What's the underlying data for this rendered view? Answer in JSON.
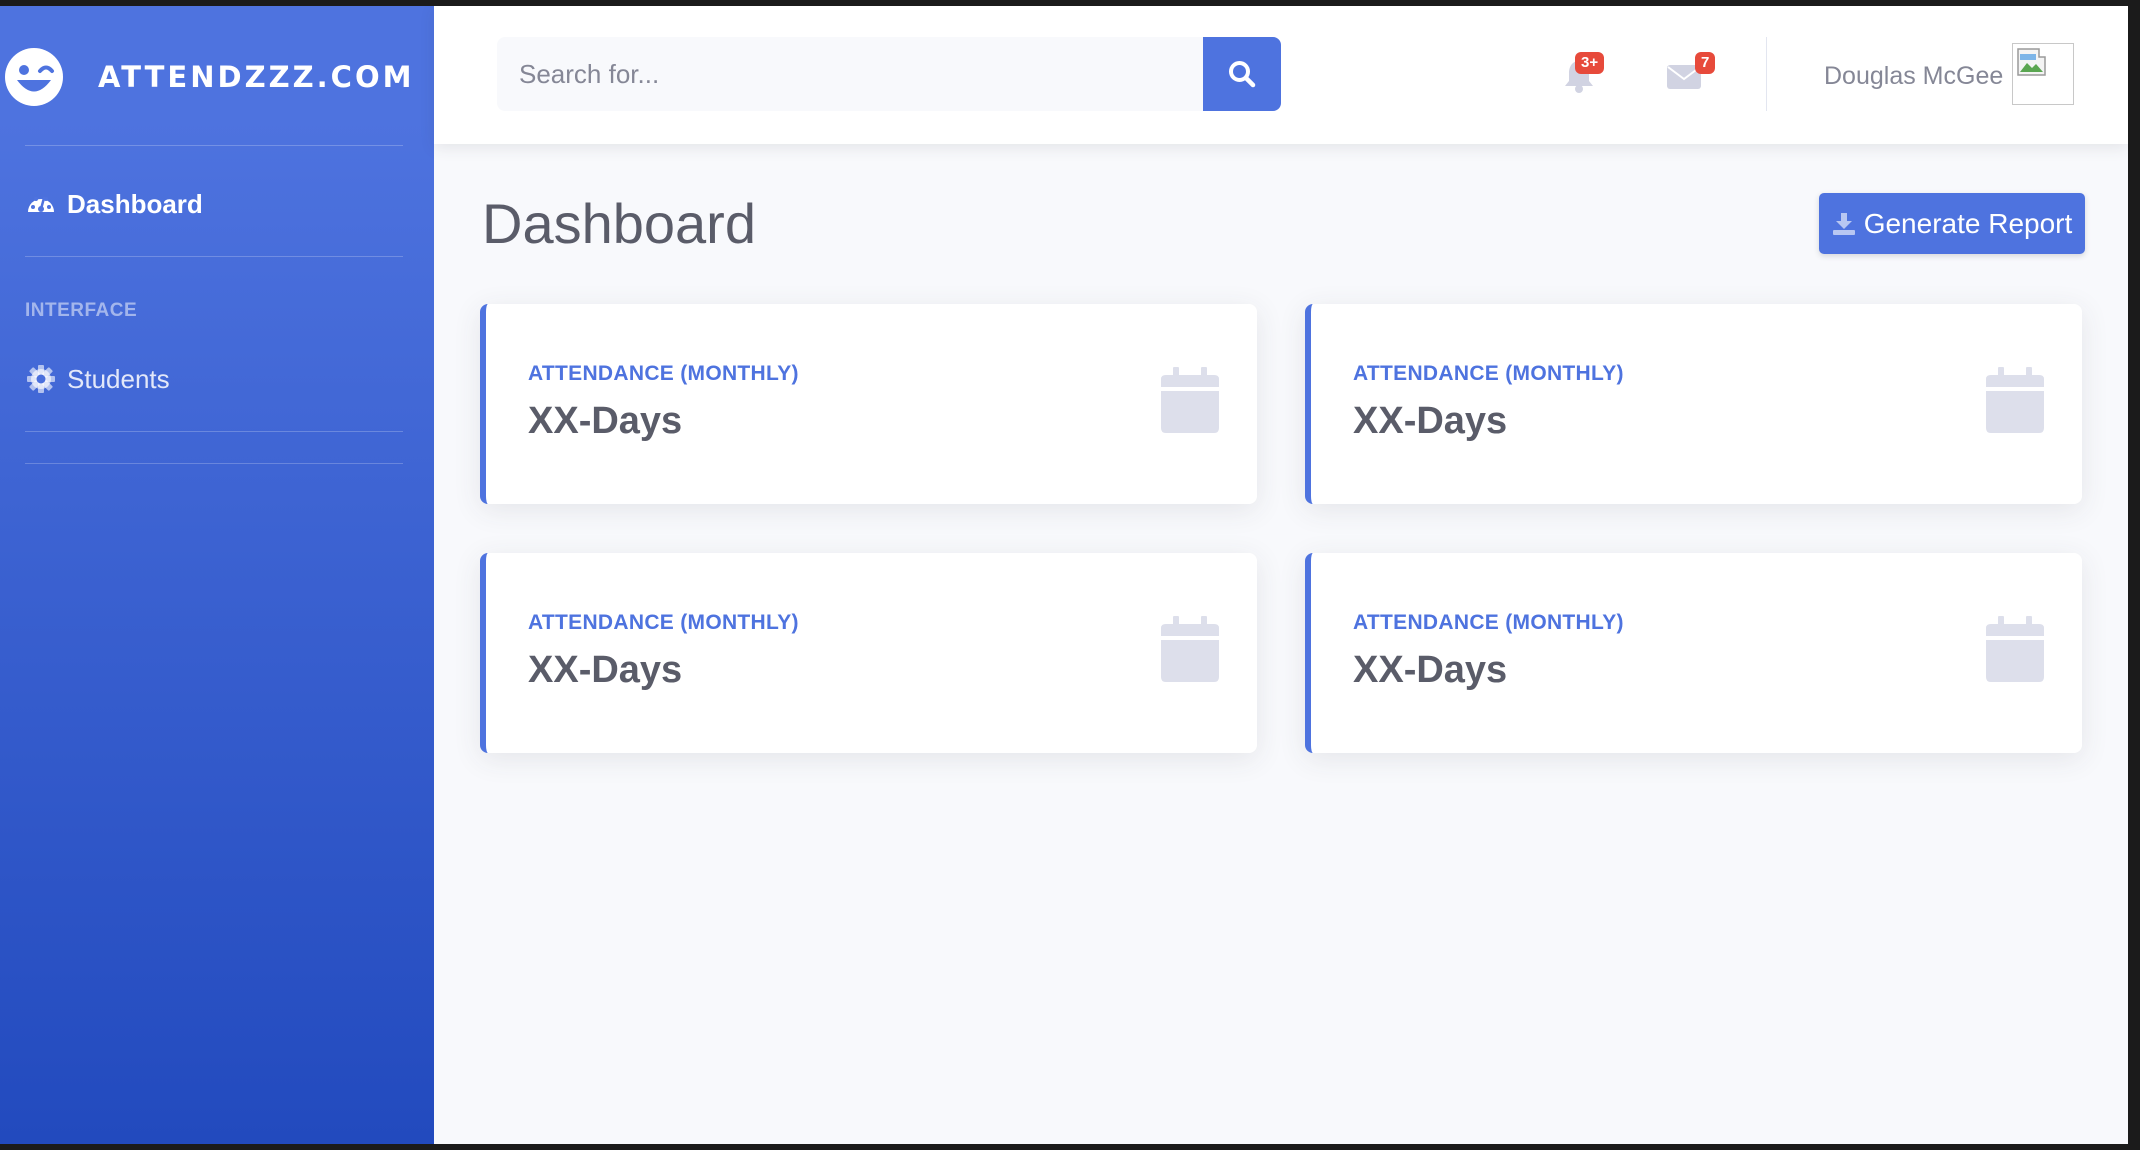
{
  "brand": {
    "icon": "laugh-wink-icon",
    "name": "ATTENDZZZ.COM"
  },
  "sidebar": {
    "items": [
      {
        "label": "Dashboard",
        "icon": "tachometer-icon",
        "active": true
      },
      {
        "label": "Students",
        "icon": "cog-icon",
        "active": false
      }
    ],
    "heading": "INTERFACE"
  },
  "topbar": {
    "search": {
      "placeholder": "Search for...",
      "value": ""
    },
    "alerts": {
      "icon": "bell-icon",
      "badge": "3+"
    },
    "messages": {
      "icon": "envelope-icon",
      "badge": "7"
    },
    "user": {
      "name": "Douglas McGee"
    }
  },
  "page": {
    "title": "Dashboard",
    "report_button": "Generate Report"
  },
  "cards": [
    {
      "label": "ATTENDANCE (MONTHLY)",
      "value": "XX-Days",
      "icon": "calendar-icon"
    },
    {
      "label": "ATTENDANCE (MONTHLY)",
      "value": "XX-Days",
      "icon": "calendar-icon"
    },
    {
      "label": "ATTENDANCE (MONTHLY)",
      "value": "XX-Days",
      "icon": "calendar-icon"
    },
    {
      "label": "ATTENDANCE (MONTHLY)",
      "value": "XX-Days",
      "icon": "calendar-icon"
    }
  ],
  "colors": {
    "primary": "#4e73df",
    "sidebar_gradient_end": "#224abe",
    "danger": "#e74a3b",
    "text_dark": "#5a5c69",
    "text_muted": "#858796"
  }
}
